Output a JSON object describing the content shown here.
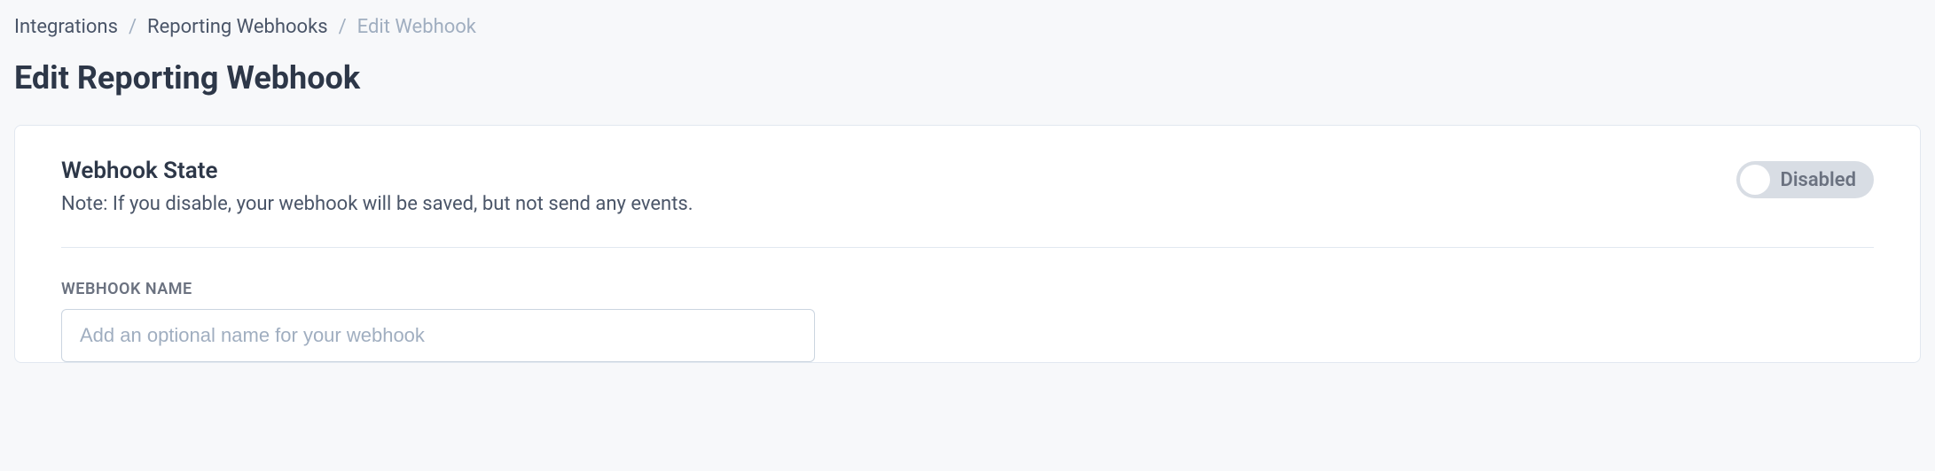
{
  "breadcrumb": {
    "items": [
      {
        "label": "Integrations"
      },
      {
        "label": "Reporting Webhooks"
      }
    ],
    "current": "Edit Webhook",
    "separator": "/"
  },
  "page_title": "Edit Reporting Webhook",
  "state_section": {
    "heading": "Webhook State",
    "note": "Note: If you disable, your webhook will be saved, but not send any events.",
    "toggle_label": "Disabled"
  },
  "name_field": {
    "label": "WEBHOOK NAME",
    "placeholder": "Add an optional name for your webhook",
    "value": ""
  }
}
